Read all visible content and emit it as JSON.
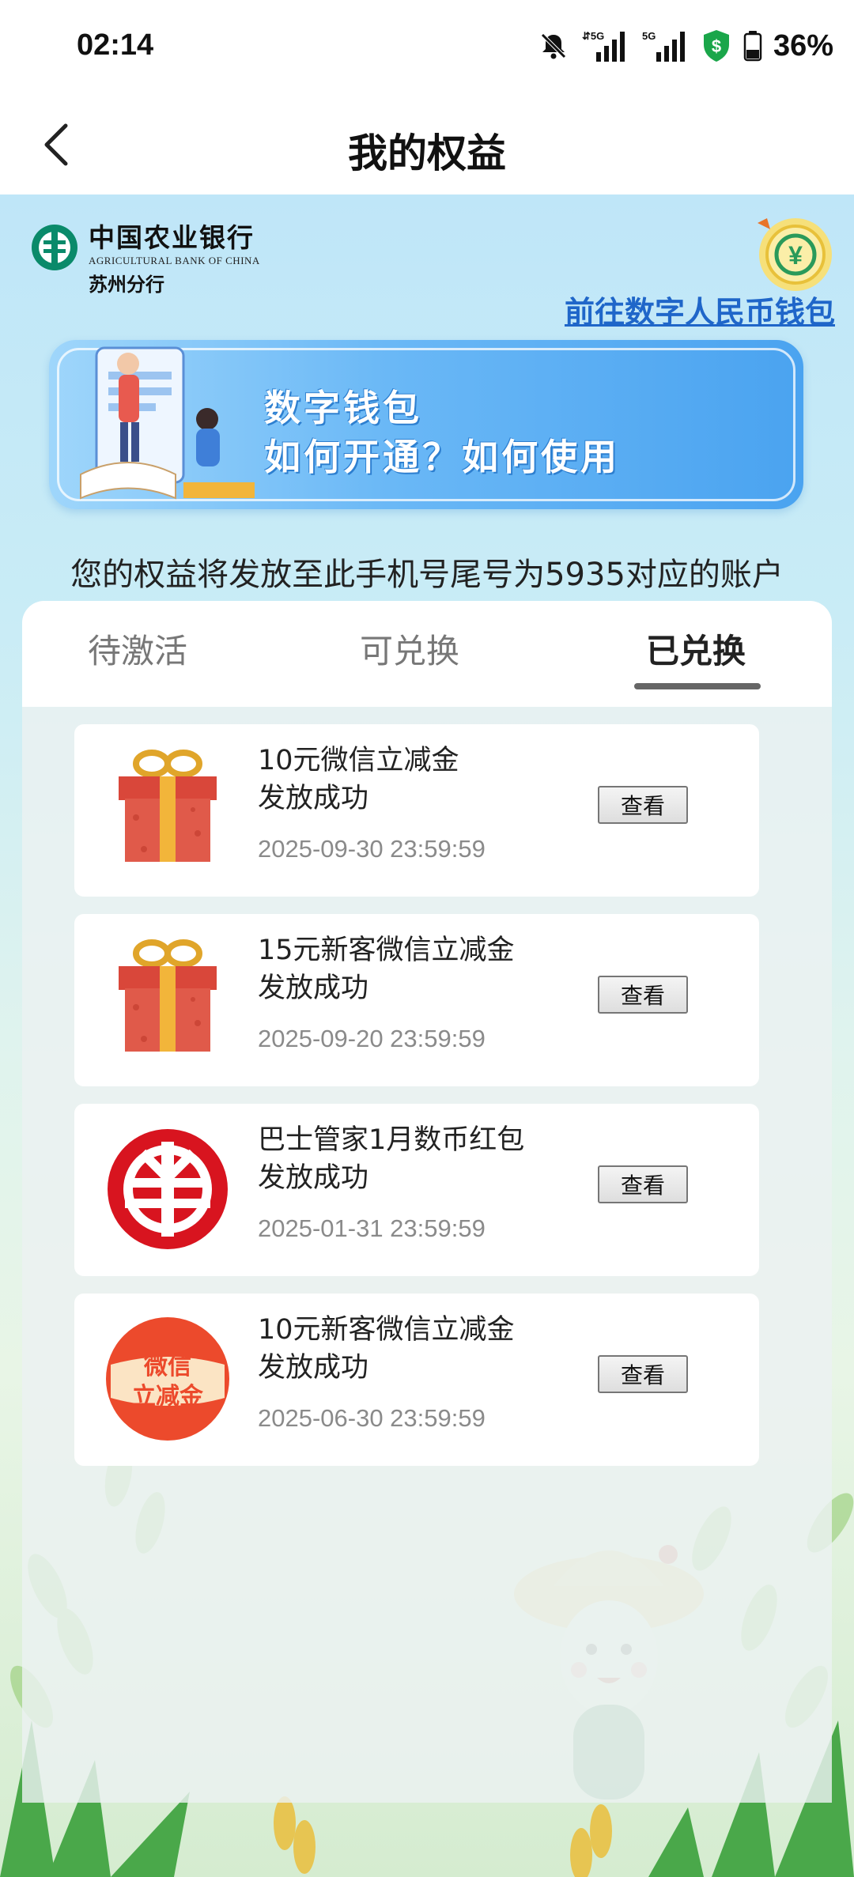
{
  "status": {
    "time": "02:14",
    "battery": "36%",
    "net1": "5G",
    "net2": "5G"
  },
  "header": {
    "title": "我的权益"
  },
  "bank": {
    "name_cn": "中国农业银行",
    "name_en": "AGRICULTURAL BANK OF CHINA",
    "branch": "苏州分行"
  },
  "wallet_link": "前往数字人民币钱包",
  "banner": {
    "line1": "数字钱包",
    "line2": "如何开通？如何使用"
  },
  "notice": "您的权益将发放至此手机号尾号为5935对应的账户",
  "tabs": [
    {
      "label": "待激活",
      "active": false
    },
    {
      "label": "可兑换",
      "active": false
    },
    {
      "label": "已兑换",
      "active": true
    }
  ],
  "items": [
    {
      "title": "10元微信立减金",
      "status": "发放成功",
      "date": "2025-09-30 23:59:59",
      "icon": "gift-icon",
      "button": "查看"
    },
    {
      "title": "15元新客微信立减金",
      "status": "发放成功",
      "date": "2025-09-20 23:59:59",
      "icon": "gift-icon",
      "button": "查看"
    },
    {
      "title": "巴士管家1月数币红包",
      "status": "发放成功",
      "date": "2025-01-31 23:59:59",
      "icon": "digital-rmb-icon",
      "button": "查看"
    },
    {
      "title": "10元新客微信立减金",
      "status": "发放成功",
      "date": "2025-06-30 23:59:59",
      "icon": "wechat-discount-icon",
      "icon_text": [
        "微信",
        "立减金"
      ],
      "button": "查看"
    }
  ],
  "colors": {
    "link": "#1f66c9",
    "bank_green": "#0a8a6a",
    "gift_red": "#d9473a",
    "ribbon_gold": "#f2b53a"
  }
}
